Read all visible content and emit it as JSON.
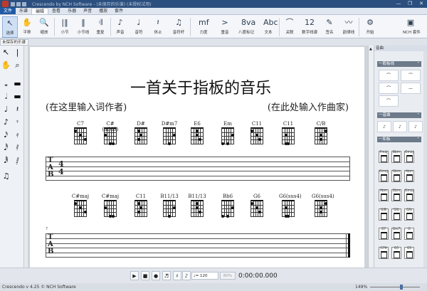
{
  "window": {
    "title": "Crescendo by NCH Software - (未保存的乐谱) (未授权试用)",
    "controls": [
      "—",
      "❐",
      "✕"
    ]
  },
  "menu": [
    "文件",
    "乐谱",
    "编辑",
    "查看",
    "乐器",
    "声音",
    "播放",
    "套件"
  ],
  "ribbon": [
    {
      "label": "选择",
      "icon": "↖",
      "name": "select"
    },
    {
      "label": "平移",
      "icon": "✋",
      "name": "pan"
    },
    {
      "label": "缩放",
      "icon": "🔍",
      "name": "zoom"
    },
    {
      "label": "小节",
      "icon": "|‖",
      "name": "measure"
    },
    {
      "label": "小节线",
      "icon": "‖",
      "name": "barline"
    },
    {
      "label": "重复",
      "icon": "𝄇",
      "name": "repeat"
    },
    {
      "label": "声音",
      "icon": "♪",
      "name": "voice"
    },
    {
      "label": "音符",
      "icon": "♩",
      "name": "note"
    },
    {
      "label": "休止",
      "icon": "𝄽",
      "name": "rest"
    },
    {
      "label": "音符杆",
      "icon": "♫",
      "name": "stem"
    },
    {
      "label": "力度",
      "icon": "mf",
      "name": "dynamics"
    },
    {
      "label": "重音",
      "icon": ">",
      "name": "accent"
    },
    {
      "label": "八度标记",
      "icon": "8va",
      "name": "octave"
    },
    {
      "label": "文本",
      "icon": "Abc",
      "name": "text"
    },
    {
      "label": "关联",
      "icon": "⌒",
      "name": "tie"
    },
    {
      "label": "数字线谱",
      "icon": "12",
      "name": "tablature"
    },
    {
      "label": "签名",
      "icon": "✎",
      "name": "signature"
    },
    {
      "label": "韵律线",
      "icon": "〰",
      "name": "rhythm-line"
    },
    {
      "label": "开始",
      "icon": "⚙",
      "name": "start"
    },
    {
      "label": "NCH 套件",
      "icon": "▣",
      "name": "nch-suite"
    }
  ],
  "doc_tab": "未保存的乐谱",
  "score": {
    "title": "一首关于指板的音乐",
    "lyricist": "(在这里输入词作者)",
    "composer": "(在此处输入作曲家)",
    "tab_label_top": "T",
    "tab_label_mid": "A",
    "tab_label_bot": "B",
    "time_top": "4",
    "time_bottom": "4",
    "measure2": "7",
    "row1_chords": [
      "C7",
      "C#(add9)",
      "D#",
      "D#m7",
      "E6",
      "Em",
      "C11",
      "C11",
      "C/B"
    ],
    "row2_chords": [
      "C#maj",
      "C#maj",
      "C11",
      "B11/13",
      "B11/13",
      "Bb6",
      "G6",
      "G6(sus4)",
      "G6(sus4)"
    ]
  },
  "right_panel": {
    "header": "音曲",
    "section1": "一般板线",
    "section2": "一音曲",
    "section3": "一和板",
    "chord_cells": [
      "Fmaj",
      "Bbm",
      "Gmaj",
      "Gmaj",
      "Gbm",
      "Abm",
      "Abm",
      "Gbm",
      "Gmaj",
      "G/B",
      "G/b",
      "G/b",
      "G7",
      "Gm7",
      "G",
      "G79",
      "G5",
      "G5"
    ]
  },
  "transport": {
    "tempo": "♩= 120",
    "zoom": "80%",
    "time": "0:00:00.000"
  },
  "status": {
    "text": "Crescendo v 4.25 © NCH Software",
    "zoom": "149%"
  }
}
